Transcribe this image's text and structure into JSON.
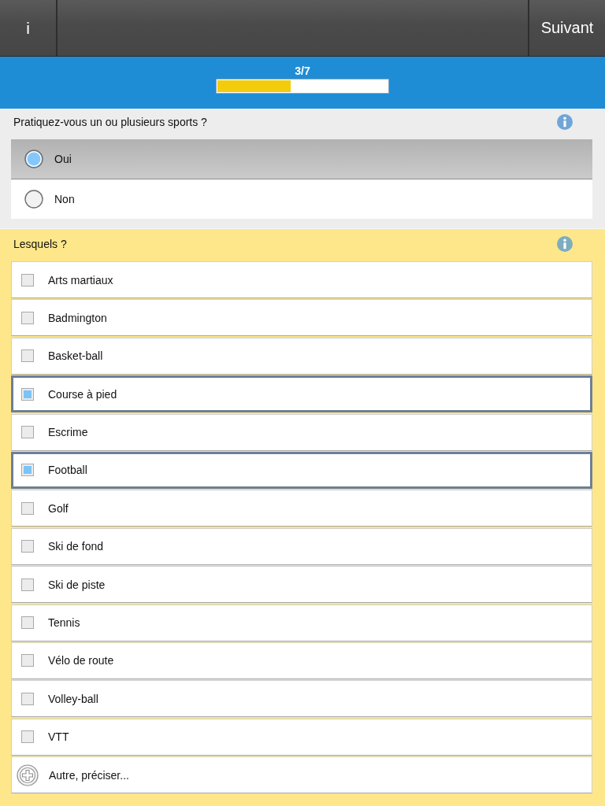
{
  "toolbar": {
    "info_button": "i",
    "next_button": "Suivant"
  },
  "progress": {
    "label": "3/7",
    "level": 0.43
  },
  "questions": [
    {
      "kind": "single",
      "text": "Pratiquez-vous un ou plusieurs sports ?",
      "options": [
        {
          "label": "Oui",
          "selected": true
        },
        {
          "label": "Non",
          "selected": false
        }
      ]
    },
    {
      "kind": "multiple",
      "text": "Lesquels ?",
      "options": [
        {
          "label": "Arts martiaux",
          "checked": false
        },
        {
          "label": "Badmington",
          "checked": false
        },
        {
          "label": "Basket-ball",
          "checked": false
        },
        {
          "label": "Course à pied",
          "checked": true
        },
        {
          "label": "Escrime",
          "checked": false
        },
        {
          "label": "Football",
          "checked": true
        },
        {
          "label": "Golf",
          "checked": false
        },
        {
          "label": "Ski de fond",
          "checked": false
        },
        {
          "label": "Ski de piste",
          "checked": false
        },
        {
          "label": "Tennis",
          "checked": false
        },
        {
          "label": "Vélo de route",
          "checked": false
        },
        {
          "label": "Volley-ball",
          "checked": false
        },
        {
          "label": "VTT",
          "checked": false
        }
      ],
      "other": "Autre, préciser..."
    }
  ]
}
